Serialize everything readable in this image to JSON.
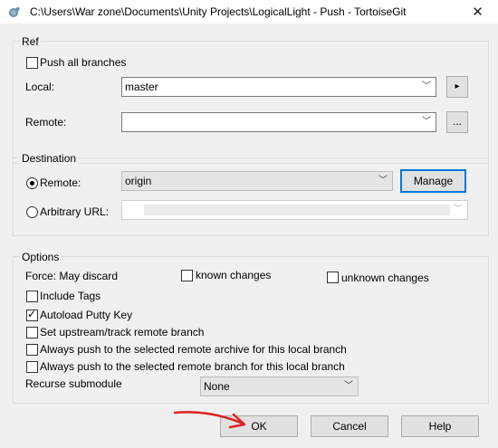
{
  "window": {
    "title": "C:\\Users\\War zone\\Documents\\Unity Projects\\LogicalLight - Push - TortoiseGit",
    "close_glyph": "✕"
  },
  "ref": {
    "legend": "Ref",
    "push_all_branches": {
      "label": "Push all branches",
      "checked": false
    },
    "local": {
      "label": "Local:",
      "value": "master",
      "browse_glyph": "▸"
    },
    "remote": {
      "label": "Remote:",
      "value": "",
      "browse_label": "..."
    }
  },
  "destination": {
    "legend": "Destination",
    "remote_radio": {
      "label": "Remote:",
      "selected": true,
      "value": "origin"
    },
    "manage_label": "Manage",
    "arbitrary_url": {
      "label": "Arbitrary URL:",
      "selected": false,
      "value": ""
    }
  },
  "options": {
    "legend": "Options",
    "force_label": "Force: May discard",
    "known_changes": {
      "label": "known changes",
      "checked": false
    },
    "unknown_changes": {
      "label": "unknown changes",
      "checked": false
    },
    "include_tags": {
      "label": "Include Tags",
      "checked": false
    },
    "autoload_putty": {
      "label": "Autoload Putty Key",
      "checked": true
    },
    "set_upstream": {
      "label": "Set upstream/track remote branch",
      "checked": false
    },
    "always_archive": {
      "label": "Always push to the selected remote archive for this local branch",
      "checked": false
    },
    "always_branch": {
      "label": "Always push to the selected remote branch for this local branch",
      "checked": false
    },
    "recurse_label": "Recurse submodule",
    "recurse_value": "None"
  },
  "buttons": {
    "ok": "OK",
    "cancel": "Cancel",
    "help": "Help"
  },
  "icons": {
    "app": "tortoisegit-icon",
    "dropdown": "chevron-down-icon",
    "annotation": "red-arrow-annotation"
  },
  "colors": {
    "accent": "#0078d7",
    "annotation": "#e02020"
  }
}
